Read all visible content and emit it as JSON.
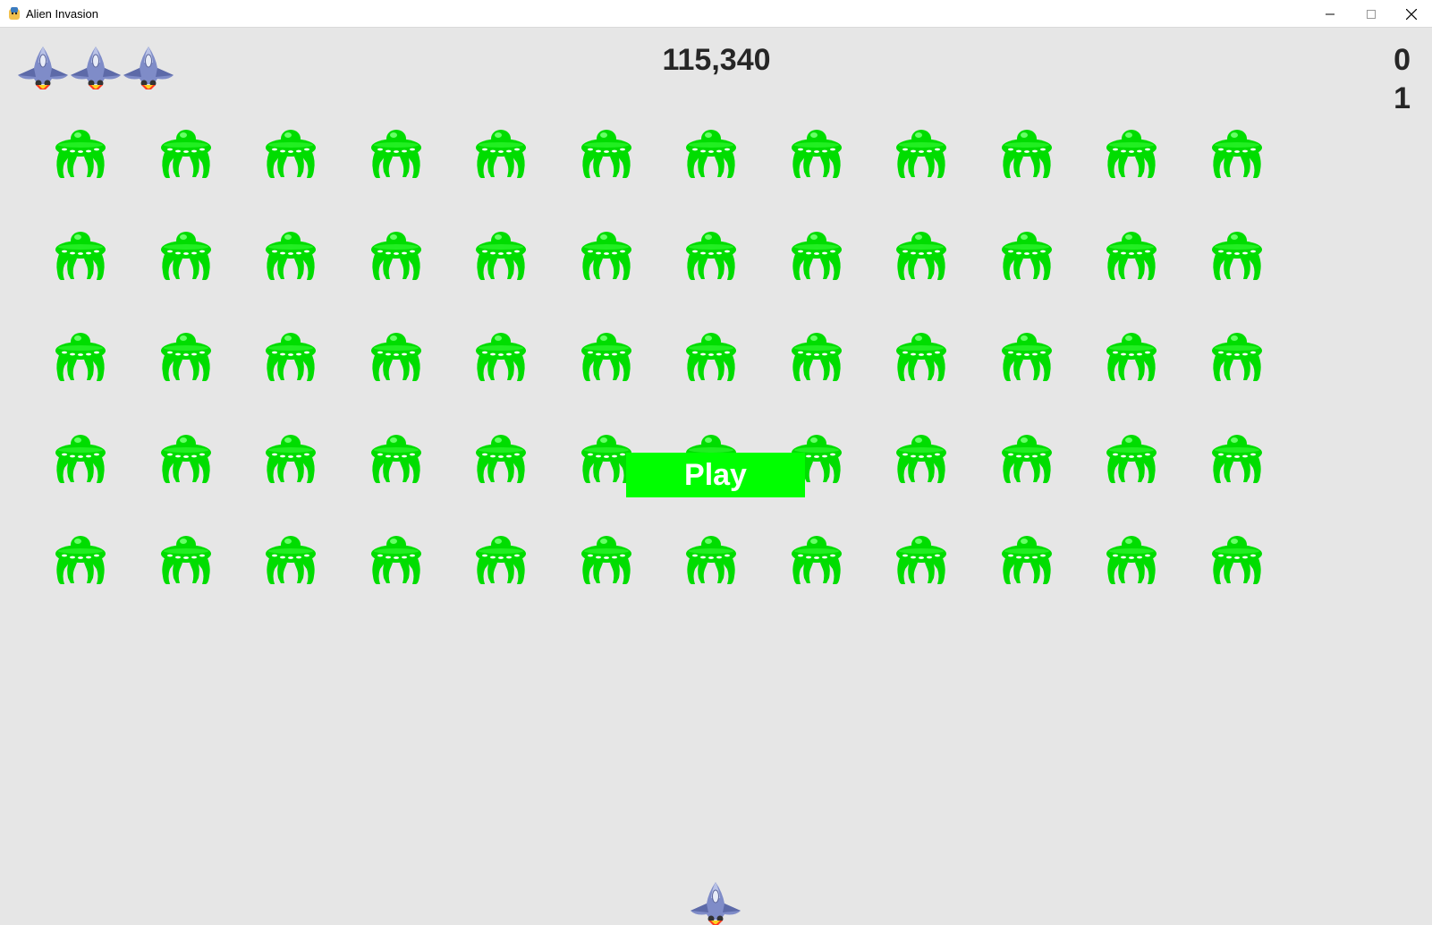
{
  "window": {
    "title": "Alien Invasion",
    "app_icon": "pygame-snake-icon",
    "controls": [
      "minimize-icon",
      "maximize-icon",
      "close-icon"
    ]
  },
  "scoreboard": {
    "score": "115,340",
    "high_score": "0",
    "level": "1"
  },
  "lives": {
    "count": 3,
    "icon": "ship-icon"
  },
  "fleet": {
    "rows": 5,
    "columns": 12,
    "alien_icon": "alien-ufo-icon",
    "alien_color": "#00dd00"
  },
  "play_button": {
    "label": "Play",
    "color": "#00ff00",
    "text_color": "#ffffff"
  },
  "player": {
    "icon": "ship-icon"
  },
  "colors": {
    "background": "#e6e6e6",
    "text": "#262626"
  }
}
